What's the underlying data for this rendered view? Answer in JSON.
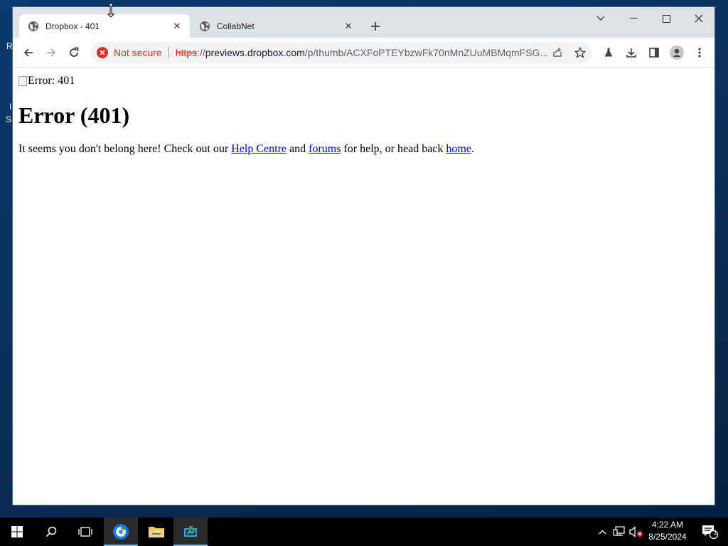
{
  "browser": {
    "tabs": [
      {
        "title": "Dropbox - 401",
        "active": true
      },
      {
        "title": "CollabNet",
        "active": false
      }
    ],
    "omnibox": {
      "security": "Not secure",
      "url_scheme": "https",
      "url_sep": "://",
      "url_host": "previews.dropbox.com",
      "url_path": "/p/thumb/ACXFoPTEYbzwFk70nMnZUuMBMqmFSG..."
    }
  },
  "page": {
    "broken_image_alt": "Error: 401",
    "heading": "Error (401)",
    "message": {
      "part1": "It seems you don't belong here! Check out our ",
      "link1": "Help Centre",
      "part2": " and ",
      "link2": "forums",
      "part3": " for help, or head back ",
      "link3": "home",
      "part4": "."
    }
  },
  "taskbar": {
    "clock_time": "4:22 AM",
    "clock_date": "8/25/2024",
    "notification_count": "1"
  },
  "desktop": {
    "fragments": [
      "R",
      "I",
      "S"
    ]
  },
  "colors": {
    "desktop": "#0b2d57",
    "tabstrip": "#dee1e6",
    "not_secure": "#d93025",
    "link": "#0000ee",
    "taskbar": "#000000"
  }
}
